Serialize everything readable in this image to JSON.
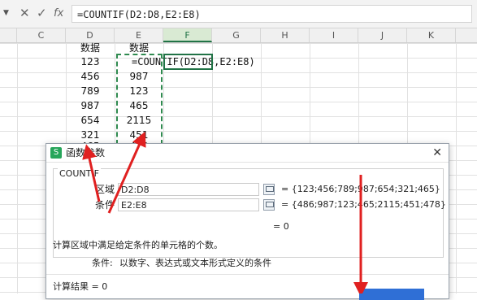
{
  "formula_bar": {
    "dropdown_icon": "chevron-down-icon",
    "cancel_icon": "✕",
    "confirm_icon": "✓",
    "fx_label": "fx",
    "formula": "=COUNTIF(D2:D8,E2:E8)"
  },
  "columns": [
    "C",
    "D",
    "E",
    "F",
    "G",
    "H",
    "I",
    "J",
    "K"
  ],
  "active_column": "F",
  "sheet": {
    "d_header": "数据",
    "e_header": "数据",
    "d_values": [
      "123",
      "456",
      "789",
      "987",
      "654",
      "321",
      "465"
    ],
    "e_values": [
      "987",
      "123",
      "465",
      "2115",
      "451",
      "478"
    ],
    "formula_in_cell": "=COUNTIF(D2:D8,E2:E8)"
  },
  "dialog": {
    "title": "函数参数",
    "close_label": "✕",
    "function_name": "COUNTIF",
    "arg1_label": "区域",
    "arg1_value": "D2:D8",
    "arg1_result": "= {123;456;789;987;654;321;465}",
    "arg2_label": "条件",
    "arg2_value": "E2:E8",
    "arg2_result": "= {486;987;123;465;2115;451;478}",
    "formula_result": "= 0",
    "description": "计算区域中满足给定条件的单元格的个数。",
    "param_desc_label": "条件:",
    "param_desc": "以数字、表达式或文本形式定义的条件",
    "calc_result": "计算结果 = 0"
  },
  "colors": {
    "accent": "#217346",
    "arrow": "#e02020",
    "ok_button": "#2f6fd6"
  }
}
